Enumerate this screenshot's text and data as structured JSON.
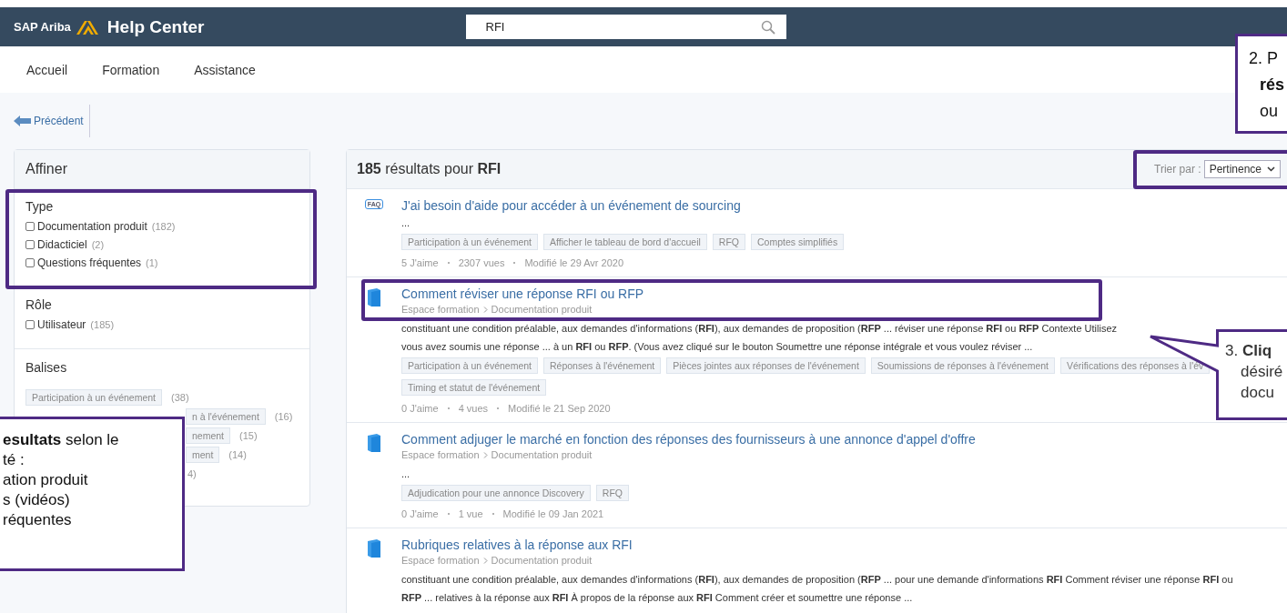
{
  "header": {
    "brand": "SAP Ariba",
    "title": "Help Center",
    "search": {
      "value": "RFI"
    }
  },
  "nav": [
    {
      "label": "Accueil"
    },
    {
      "label": "Formation"
    },
    {
      "label": "Assistance"
    }
  ],
  "back": {
    "label": "Précédent"
  },
  "refine": {
    "title": "Affiner",
    "sections": [
      {
        "title": "Type",
        "highlighted": true,
        "options": [
          {
            "label": "Documentation produit",
            "count": "(182)",
            "checked": false
          },
          {
            "label": "Didacticiel",
            "count": "(2)",
            "checked": false
          },
          {
            "label": "Questions fréquentes",
            "count": "(1)",
            "checked": false
          }
        ]
      },
      {
        "title": "Rôle",
        "highlighted": false,
        "options": [
          {
            "label": "Utilisateur",
            "count": "(185)",
            "checked": false
          }
        ]
      }
    ],
    "tags_title": "Balises",
    "tags": [
      {
        "kind": "full",
        "label": "Participation à un événement",
        "count": "(38)"
      },
      {
        "kind": "partial",
        "label": "n à l'événement",
        "count": "(16)"
      },
      {
        "kind": "partial",
        "label": "nement",
        "count": "(15)"
      },
      {
        "kind": "partial",
        "label": "ment",
        "count": "(14)"
      },
      {
        "kind": "count-only",
        "count": "4)"
      }
    ]
  },
  "results": {
    "heading": "**185** résultats pour **RFI**",
    "sort_label": "Trier par :",
    "sort_value": "Pertinence",
    "sort_highlighted": true,
    "items": [
      {
        "kind": "faq",
        "badge": "FAQ",
        "highlighted": false,
        "title": "J'ai besoin d'aide pour accéder à un événement de sourcing",
        "snippet": [
          "..."
        ],
        "tags": [
          "Participation à un événement",
          "Afficher le tableau de bord d'accueil",
          "RFQ",
          "Comptes simplifiés"
        ],
        "meta": [
          "5 J'aime",
          "2307 vues",
          "Modifié le 29 Avr 2020"
        ]
      },
      {
        "kind": "doc",
        "highlighted": true,
        "title": "Comment réviser une réponse RFI ou RFP",
        "path": [
          "Espace formation",
          "Documentation produit"
        ],
        "snippet": [
          "constituant une condition préalable, aux demandes d'informations (**RFI**), aux demandes de proposition (**RFP** ... réviser une réponse **RFI** ou **RFP** Contexte Utilisez",
          "vous avez soumis une réponse ... à un **RFI** ou **RFP**. (Vous avez cliqué sur le bouton Soumettre une réponse intégrale et vous voulez réviser ..."
        ],
        "tags": [
          "Participation à un événement",
          "Réponses à l'événement",
          "Pièces jointes aux réponses de l'événement",
          "Soumissions de réponses à l'événement",
          "Vérifications des réponses à l'év",
          "Timing et statut de l'événement"
        ],
        "meta": [
          "0 J'aime",
          "4 vues",
          "Modifié le 21 Sep 2020"
        ]
      },
      {
        "kind": "doc",
        "highlighted": false,
        "title": "Comment adjuger le marché en fonction des réponses des fournisseurs à une annonce d'appel d'offre",
        "path": [
          "Espace formation",
          "Documentation produit"
        ],
        "snippet": [
          "..."
        ],
        "tags": [
          "Adjudication pour une annonce Discovery",
          "RFQ"
        ],
        "meta": [
          "0 J'aime",
          "1 vue",
          "Modifié le 09 Jan 2021"
        ]
      },
      {
        "kind": "doc",
        "highlighted": false,
        "title": "Rubriques relatives à la réponse aux RFI",
        "path": [
          "Espace formation",
          "Documentation produit"
        ],
        "snippet": [
          "constituant une condition préalable, aux demandes d'informations (**RFI**), aux demandes de proposition (**RFP** ... pour une demande d'informations **RFI** Comment réviser une réponse **RFI** ou",
          "**RFP** ... relatives à la réponse aux **RFI** À propos de la réponse aux **RFI** Comment créer et soumettre une réponse ..."
        ]
      }
    ]
  },
  "callouts": [
    {
      "kind": "filter",
      "lines": [
        "**esultats** selon le",
        "té :",
        "ation produit",
        "s (vidéos)",
        "réquentes"
      ]
    },
    {
      "kind": "sort",
      "lines": [
        "2. P",
        "**rés**",
        "ou"
      ]
    },
    {
      "kind": "click",
      "lines": [
        "3. **Cliq**",
        "désiré",
        "docu"
      ]
    }
  ]
}
